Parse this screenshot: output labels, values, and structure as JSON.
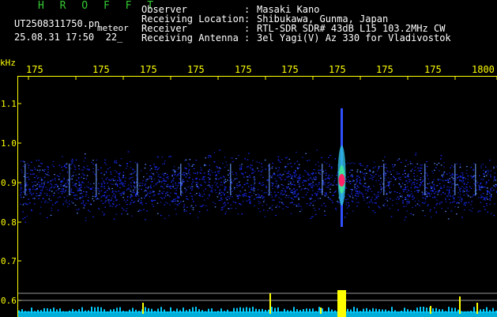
{
  "header": {
    "brand": "H R O F F T",
    "filename": "UT2508311750.pn",
    "subtitle": "meteor",
    "datetime": "25.08.31 17:50  22_",
    "meta": [
      {
        "label": "Observer",
        "sep": ":",
        "value": "Masaki Kano"
      },
      {
        "label": "Receiving Location",
        "sep": ":",
        "value": "Shibukawa, Gunma, Japan"
      },
      {
        "label": "Receiver",
        "sep": ":",
        "value": "RTL-SDR SDR# 43dB L15 103.2MHz CW"
      },
      {
        "label": "Receiving Antenna",
        "sep": ":",
        "value": "3el Yagi(V) Az 330 for Vladivostok"
      }
    ]
  },
  "axes": {
    "y_unit": "kHz",
    "x_ticks": [
      "175",
      "175",
      "175",
      "175",
      "175",
      "175",
      "175",
      "175",
      "175",
      "1800"
    ],
    "y_ticks": [
      "1.1",
      "1.0",
      "0.9",
      "0.8",
      "0.7",
      "0.6"
    ]
  },
  "colors": {
    "axis": "#ffff00",
    "noise": "#1a2aff",
    "meteor_core": "#ff2266",
    "power": "#ffff00",
    "baseline": "#00ccff"
  }
}
